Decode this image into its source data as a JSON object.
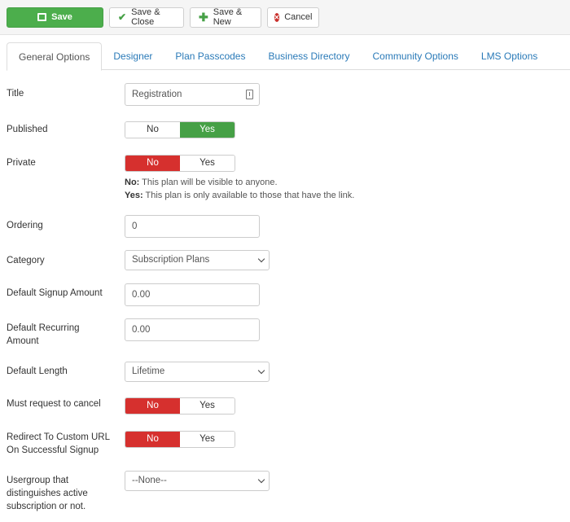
{
  "toolbar": {
    "save": "Save",
    "save_close": "Save & Close",
    "save_new": "Save & New",
    "cancel": "Cancel"
  },
  "tabs": [
    {
      "label": "General Options",
      "active": true
    },
    {
      "label": "Designer"
    },
    {
      "label": "Plan Passcodes"
    },
    {
      "label": "Business Directory"
    },
    {
      "label": "Community Options"
    },
    {
      "label": "LMS Options"
    }
  ],
  "colors": {
    "success": "#46a046",
    "danger": "#d6302e",
    "link": "#2a7ab8"
  },
  "fields": {
    "title": {
      "label": "Title",
      "value": "Registration"
    },
    "published": {
      "label": "Published",
      "no": "No",
      "yes": "Yes",
      "selected": "Yes"
    },
    "private": {
      "label": "Private",
      "no": "No",
      "yes": "Yes",
      "selected": "No",
      "help_no_label": "No:",
      "help_no_text": " This plan will be visible to anyone.",
      "help_yes_label": "Yes:",
      "help_yes_text": " This plan is only available to those that have the link."
    },
    "ordering": {
      "label": "Ordering",
      "value": "0"
    },
    "category": {
      "label": "Category",
      "value": "Subscription Plans"
    },
    "signup_amount": {
      "label": "Default Signup Amount",
      "value": "0.00"
    },
    "recurring_amount": {
      "label": "Default Recurring Amount",
      "value": "0.00"
    },
    "length": {
      "label": "Default Length",
      "value": "Lifetime"
    },
    "must_cancel": {
      "label": "Must request to cancel",
      "no": "No",
      "yes": "Yes",
      "selected": "No"
    },
    "redirect": {
      "label": "Redirect To Custom URL On Successful Signup",
      "no": "No",
      "yes": "Yes",
      "selected": "No"
    },
    "usergroup": {
      "label": "Usergroup that distinguishes active subscription or not.",
      "value": "--None--"
    }
  }
}
